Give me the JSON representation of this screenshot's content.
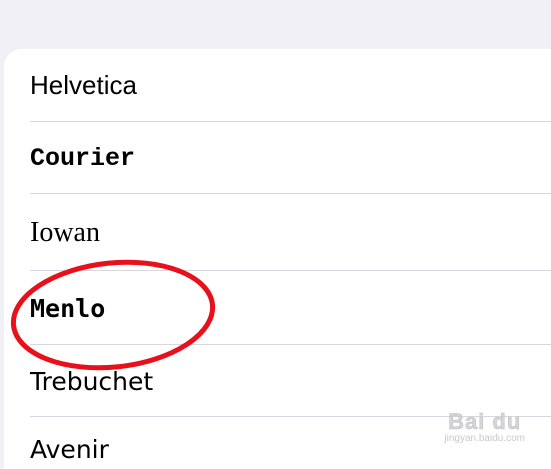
{
  "font_list": {
    "items": [
      {
        "label": "Helvetica"
      },
      {
        "label": "Courier"
      },
      {
        "label": "Iowan"
      },
      {
        "label": "Menlo"
      },
      {
        "label": "Trebuchet"
      },
      {
        "label": "Avenir"
      }
    ]
  },
  "annotation": {
    "color": "#e8101a",
    "target": "Menlo"
  },
  "watermark": {
    "brand": "Bai du",
    "sub": "jingyan.baidu.com"
  }
}
